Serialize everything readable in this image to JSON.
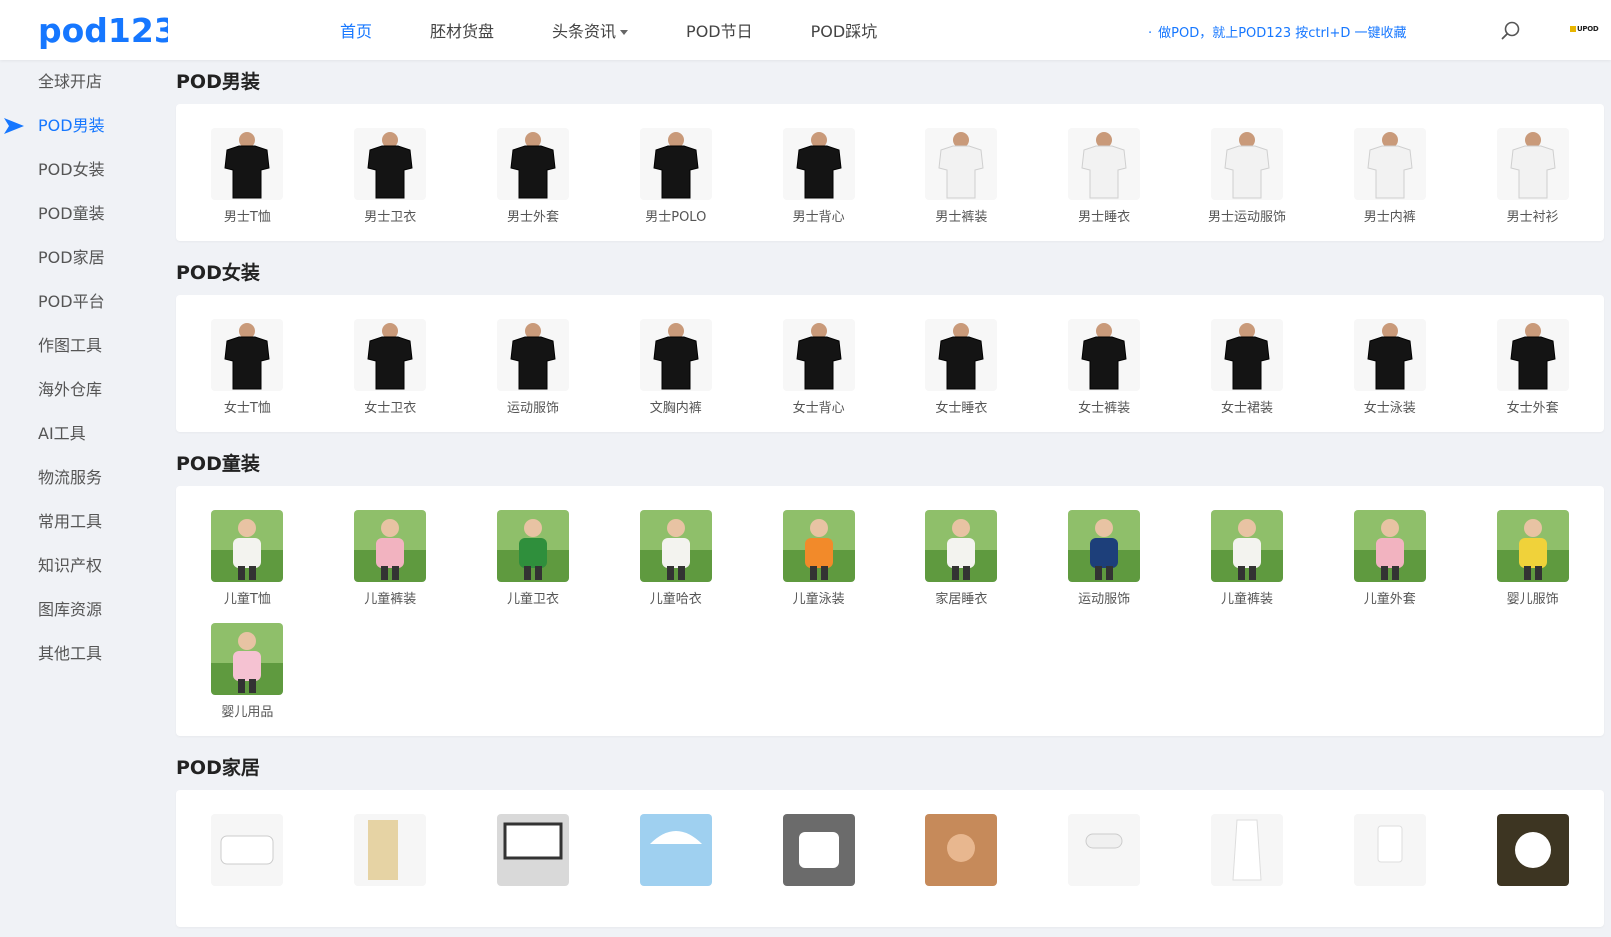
{
  "header": {
    "logo_text": "pod123",
    "nav": [
      {
        "label": "首页",
        "active": true
      },
      {
        "label": "胚材货盘",
        "active": false
      },
      {
        "label": "头条资讯",
        "active": false,
        "dropdown": true
      },
      {
        "label": "POD节日",
        "active": false
      },
      {
        "label": "POD踩坑",
        "active": false
      }
    ],
    "notice": "做POD，就上POD123 按ctrl+D 一键收藏",
    "notice_dot": "·",
    "mini_logo_text": "UPOD"
  },
  "sidebar": {
    "items": [
      {
        "label": "全球开店",
        "active": false
      },
      {
        "label": "POD男装",
        "active": true
      },
      {
        "label": "POD女装",
        "active": false
      },
      {
        "label": "POD童装",
        "active": false
      },
      {
        "label": "POD家居",
        "active": false
      },
      {
        "label": "POD平台",
        "active": false
      },
      {
        "label": "作图工具",
        "active": false
      },
      {
        "label": "海外仓库",
        "active": false
      },
      {
        "label": "AI工具",
        "active": false
      },
      {
        "label": "物流服务",
        "active": false
      },
      {
        "label": "常用工具",
        "active": false
      },
      {
        "label": "知识产权",
        "active": false
      },
      {
        "label": "图库资源",
        "active": false
      },
      {
        "label": "其他工具",
        "active": false
      }
    ]
  },
  "sections": [
    {
      "title": "POD男装",
      "items": [
        {
          "label": "男士T恤",
          "icon": "black-tshirt-man"
        },
        {
          "label": "男士卫衣",
          "icon": "black-sweatshirt-man"
        },
        {
          "label": "男士外套",
          "icon": "black-jacket-man"
        },
        {
          "label": "男士POLO",
          "icon": "black-polo-man"
        },
        {
          "label": "男士背心",
          "icon": "black-tank-man"
        },
        {
          "label": "男士裤装",
          "icon": "white-shorts"
        },
        {
          "label": "男士睡衣",
          "icon": "white-pajama-man"
        },
        {
          "label": "男士运动服饰",
          "icon": "white-sportswear-man"
        },
        {
          "label": "男士内裤",
          "icon": "white-briefs"
        },
        {
          "label": "男士衬衫",
          "icon": "white-shirt-man"
        }
      ]
    },
    {
      "title": "POD女装",
      "items": [
        {
          "label": "女士T恤",
          "icon": "black-tshirt-woman"
        },
        {
          "label": "女士卫衣",
          "icon": "black-hoodie-woman"
        },
        {
          "label": "运动服饰",
          "icon": "black-sportswear-woman"
        },
        {
          "label": "文胸内裤",
          "icon": "black-bra"
        },
        {
          "label": "女士背心",
          "icon": "black-tank-woman"
        },
        {
          "label": "女士睡衣",
          "icon": "black-pajama-woman"
        },
        {
          "label": "女士裤装",
          "icon": "black-shorts-woman"
        },
        {
          "label": "女士裙装",
          "icon": "black-dress"
        },
        {
          "label": "女士泳装",
          "icon": "black-swimsuit"
        },
        {
          "label": "女士外套",
          "icon": "black-puffer-jacket"
        }
      ]
    },
    {
      "title": "POD童装",
      "items": [
        {
          "label": "儿童T恤",
          "icon": "kid-tshirt"
        },
        {
          "label": "儿童裤装",
          "icon": "pink-kid-pants"
        },
        {
          "label": "儿童卫衣",
          "icon": "green-kid-hoodie"
        },
        {
          "label": "儿童哈衣",
          "icon": "kid-romper"
        },
        {
          "label": "儿童泳装",
          "icon": "kid-swimwear"
        },
        {
          "label": "家居睡衣",
          "icon": "kid-pajama"
        },
        {
          "label": "运动服饰",
          "icon": "kid-sportswear"
        },
        {
          "label": "儿童裤装",
          "icon": "kid-running-pants"
        },
        {
          "label": "儿童外套",
          "icon": "kid-pink-coat"
        },
        {
          "label": "婴儿服饰",
          "icon": "baby-yellow-outfit"
        },
        {
          "label": "婴儿用品",
          "icon": "baby-blanket"
        }
      ]
    },
    {
      "title": "POD家居",
      "items": [
        {
          "label": "",
          "icon": "white-blanket"
        },
        {
          "label": "",
          "icon": "gold-frame-panel"
        },
        {
          "label": "",
          "icon": "wall-frame"
        },
        {
          "label": "",
          "icon": "beach-umbrella"
        },
        {
          "label": "",
          "icon": "white-pillow"
        },
        {
          "label": "",
          "icon": "beach-towel-woman"
        },
        {
          "label": "",
          "icon": "sleep-mask"
        },
        {
          "label": "",
          "icon": "white-apron"
        },
        {
          "label": "",
          "icon": "night-light"
        },
        {
          "label": "",
          "icon": "round-ornament"
        }
      ]
    }
  ],
  "colors": {
    "accent": "#1677ff",
    "background": "#f0f2f6",
    "panel": "#ffffff"
  }
}
